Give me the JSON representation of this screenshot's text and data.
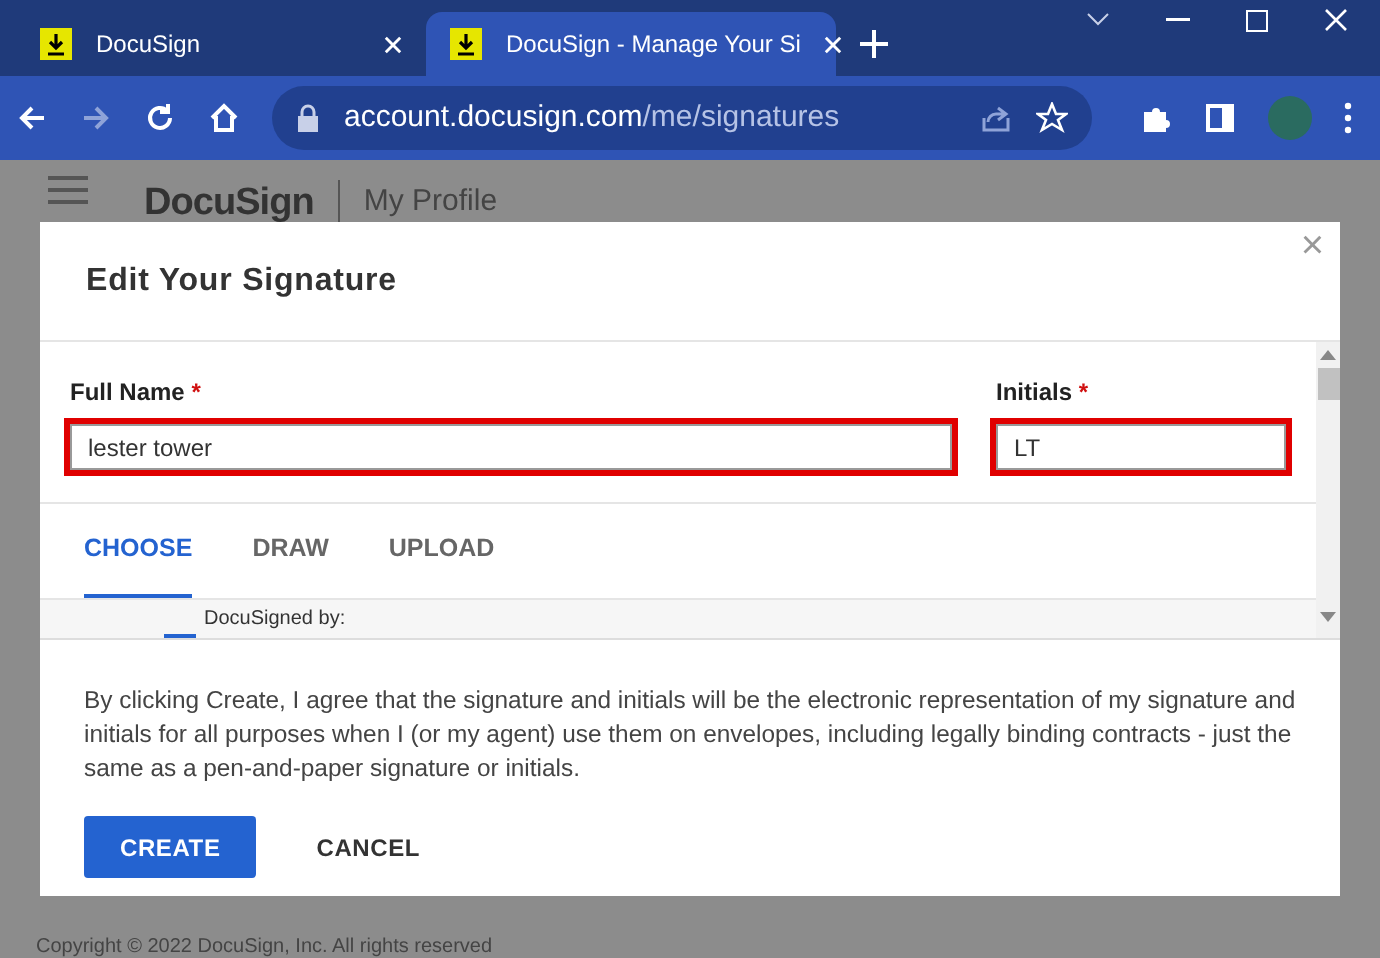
{
  "browser": {
    "tabs": [
      {
        "title": "DocuSign",
        "selected": false
      },
      {
        "title": "DocuSign - Manage Your Si",
        "selected": true
      }
    ],
    "url_host": "account.docusign.com",
    "url_path": "/me/signatures"
  },
  "page": {
    "logo": "DocuSign",
    "section": "My Profile",
    "copyright": "Copyright © 2022 DocuSign, Inc. All rights reserved"
  },
  "dialog": {
    "title": "Edit Your Signature",
    "close": "×",
    "fields": [
      {
        "label": "Full Name",
        "required_mark": "*",
        "value": "lester tower"
      },
      {
        "label": "Initials",
        "required_mark": "*",
        "value": "LT"
      }
    ],
    "tabs": [
      {
        "label": "CHOOSE",
        "selected": true
      },
      {
        "label": "DRAW",
        "selected": false
      },
      {
        "label": "UPLOAD",
        "selected": false
      }
    ],
    "signature_preview": "DocuSigned by:",
    "consent": "By clicking Create, I agree that the signature and initials will be the electronic representation of my signature and initials for all purposes when I (or my agent) use them on envelopes, including legally binding contracts - just the same as a pen-and-paper signature or initials.",
    "buttons": [
      {
        "label": "CREATE",
        "kind": "primary"
      },
      {
        "label": "CANCEL",
        "kind": "secondary"
      }
    ]
  }
}
